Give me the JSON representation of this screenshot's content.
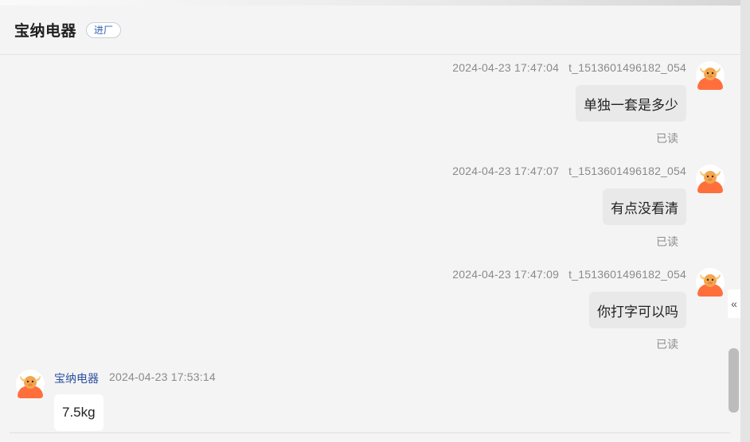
{
  "header": {
    "title": "宝纳电器",
    "status_tag": "进厂"
  },
  "outgoing_messages": [
    {
      "timestamp": "2024-04-23 17:47:04",
      "sender": "t_1513601496182_054",
      "text": "单独一套是多少",
      "read_status": "已读"
    },
    {
      "timestamp": "2024-04-23 17:47:07",
      "sender": "t_1513601496182_054",
      "text": "有点没看清",
      "read_status": "已读"
    },
    {
      "timestamp": "2024-04-23 17:47:09",
      "sender": "t_1513601496182_054",
      "text": "你打字可以吗",
      "read_status": "已读"
    }
  ],
  "incoming_messages": [
    {
      "sender": "宝纳电器",
      "timestamp": "2024-04-23 17:53:14",
      "text": "7.5kg"
    }
  ],
  "controls": {
    "collapse_icon": "double-chevron-left-icon",
    "collapse_glyph": "«"
  },
  "colors": {
    "sender_name": "#2b4fa0",
    "status_tag_text": "#2f5fb3",
    "avatar_main": "#ff6f3c"
  }
}
